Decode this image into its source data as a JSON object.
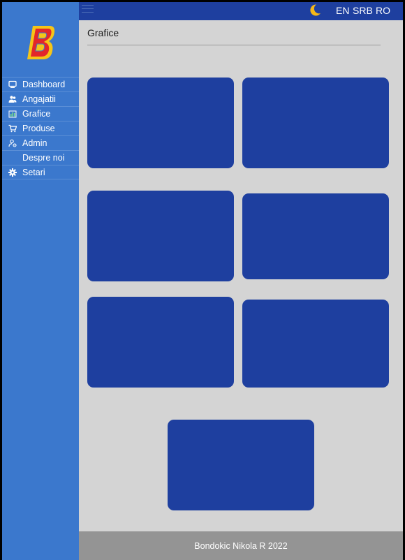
{
  "brand": {
    "logo_letter": "B",
    "colors": {
      "red": "#e2272a",
      "yellow": "#f5c518",
      "blue_dark": "#1e3f9f"
    }
  },
  "sidebar": {
    "background": "#3b78cd",
    "items": [
      {
        "label": "Dashboard",
        "icon": "monitor-icon"
      },
      {
        "label": "Angajatii",
        "icon": "users-icon"
      },
      {
        "label": "Grafice",
        "icon": "bar-chart-icon"
      },
      {
        "label": "Produse",
        "icon": "cart-icon"
      },
      {
        "label": "Admin",
        "icon": "admin-user-icon"
      },
      {
        "label": "Despre noi",
        "icon": ""
      },
      {
        "label": "Setari",
        "icon": "gear-icon"
      }
    ]
  },
  "topbar": {
    "background": "#1e3f9f",
    "theme_icon": "moon-icon",
    "languages": [
      "EN",
      "SRB",
      "RO"
    ]
  },
  "main": {
    "title": "Grafice",
    "cards": [
      {
        "name": "chart-card-1"
      },
      {
        "name": "chart-card-2"
      },
      {
        "name": "chart-card-3"
      },
      {
        "name": "chart-card-4"
      },
      {
        "name": "chart-card-5"
      },
      {
        "name": "chart-card-6"
      },
      {
        "name": "chart-card-7"
      }
    ]
  },
  "footer": {
    "text": "Bondokic Nikola R 2022"
  }
}
